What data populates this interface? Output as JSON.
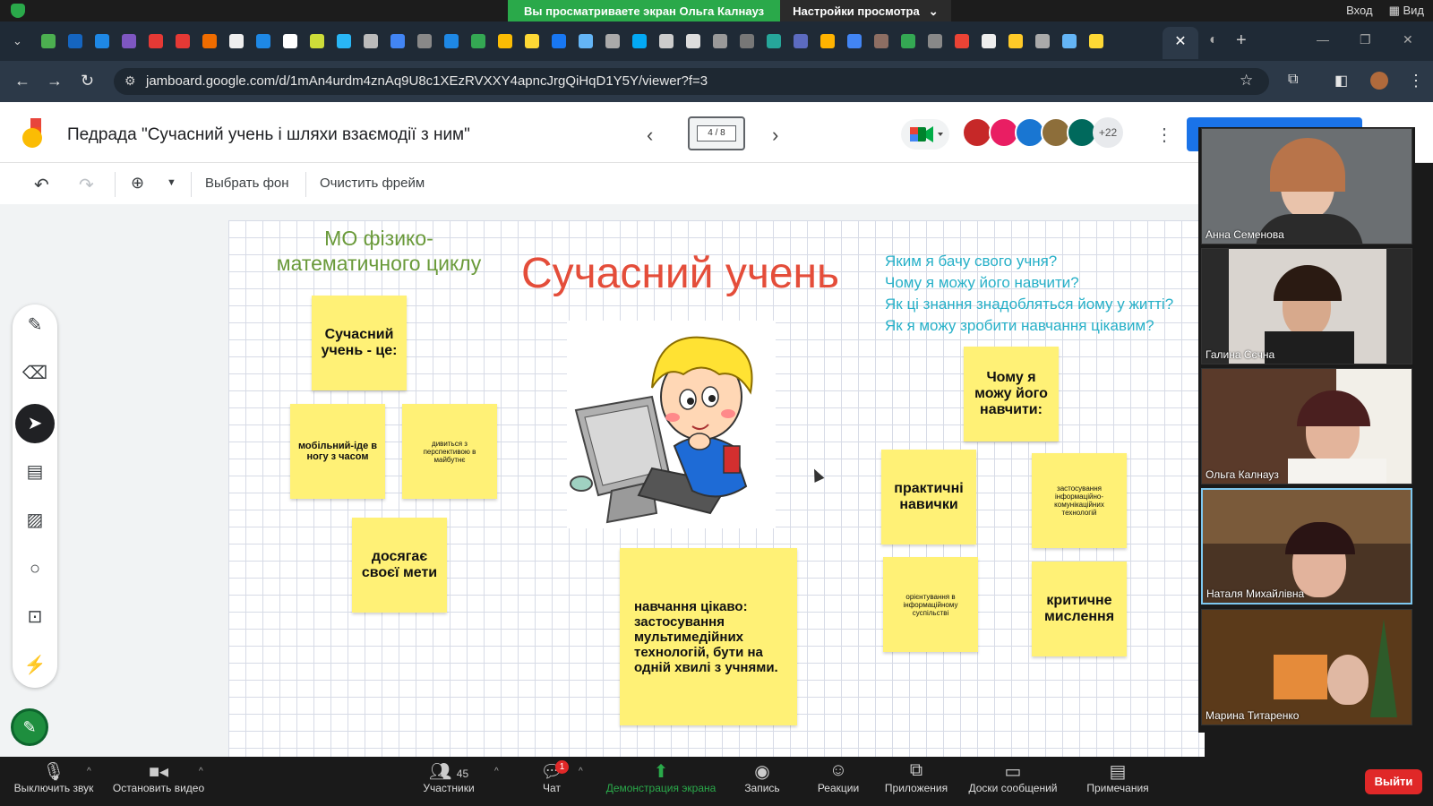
{
  "zoom_share": {
    "banner_text": "Вы просматриваете экран Ольга Калнауз",
    "settings_label": "Настройки просмотра",
    "login_label": "Вход",
    "view_label": "Вид"
  },
  "browser": {
    "url": "jamboard.google.com/d/1mAn4urdm4znAq9U8c1XEzRVXXY4apncJrgQiHqD1Y5Y/viewer?f=3"
  },
  "jamboard": {
    "title": "Педрада \"Сучасний учень і шляхи взаємодії з ним\"",
    "frame_counter": "4 / 8",
    "extra_collaborators": "+22",
    "toolbar": {
      "background_label": "Выбрать фон",
      "clear_label": "Очистить фрейм"
    }
  },
  "board": {
    "subtitle_line1": "МО фізико-",
    "subtitle_line2": "математичного циклу",
    "main_title": "Сучасний учень",
    "questions": [
      "Яким я бачу свого учня?",
      "Чому я можу його навчити?",
      "Як ці знання знадобляться йому у житті?",
      "Як я можу зробити навчання цікавим?"
    ],
    "stickies": {
      "student_is": "Сучасний учень - це:",
      "mobile": "мобільний-іде в ногу з часом",
      "perspective": "дивиться з перспективою в майбутнє",
      "goal": "досягає своєї мети",
      "interesting": "навчання цікаво: застосування мультимедійних технологій, бути на одній хвилі з учнями.",
      "why_teach": "Чому я можу його навчити:",
      "practical": "практичні навички",
      "ict": "застосування інформаційно-комунікаційних технологій",
      "orientation": "орієнтування в інформаційному суспільстві",
      "critical": "критичне мислення"
    }
  },
  "participants": [
    {
      "name": "Анна Семенова"
    },
    {
      "name": "Галина Сєчна"
    },
    {
      "name": "Ольга Калнауз"
    },
    {
      "name": "Наталя Михайлівна"
    },
    {
      "name": "Марина Титаренко"
    }
  ],
  "zoom_bar": {
    "mute": "Выключить звук",
    "stop_video": "Остановить видео",
    "participants": "Участники",
    "participants_count": "45",
    "chat": "Чат",
    "chat_badge": "1",
    "share_screen": "Демонстрация экрана",
    "record": "Запись",
    "reactions": "Реакции",
    "apps": "Приложения",
    "whiteboards": "Доски сообщений",
    "notes": "Примечания",
    "leave": "Выйти"
  },
  "colors": {
    "sticky": "#fff176",
    "title_red": "#e44d3a",
    "question_cyan": "#27b0c8",
    "subtitle_green": "#6a9a3a",
    "share_green": "#2aa94a",
    "leave_red": "#e02828"
  }
}
